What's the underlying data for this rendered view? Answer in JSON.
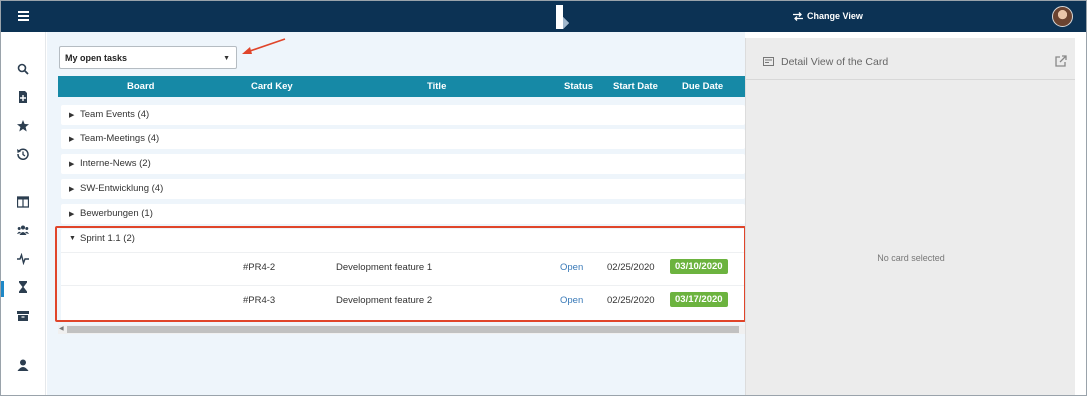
{
  "header": {
    "change_view_label": "Change View"
  },
  "filter": {
    "selected": "My open tasks"
  },
  "table": {
    "columns": {
      "board": "Board",
      "card_key": "Card Key",
      "title": "Title",
      "status": "Status",
      "start_date": "Start Date",
      "due_date": "Due Date"
    },
    "groups": [
      {
        "label": "Team Events (4)"
      },
      {
        "label": "Team-Meetings (4)"
      },
      {
        "label": "Interne-News (2)"
      },
      {
        "label": "SW-Entwicklung (4)"
      },
      {
        "label": "Bewerbungen (1)"
      },
      {
        "label": "Sprint 1.1 (2)"
      }
    ],
    "rows": [
      {
        "card_key": "#PR4-2",
        "title": "Development feature 1",
        "status": "Open",
        "start_date": "02/25/2020",
        "due_date": "03/10/2020"
      },
      {
        "card_key": "#PR4-3",
        "title": "Development feature 2",
        "status": "Open",
        "start_date": "02/25/2020",
        "due_date": "03/17/2020"
      }
    ]
  },
  "detail_panel": {
    "title": "Detail View of the Card",
    "empty_text": "No card selected"
  },
  "sidebar": {
    "icons": [
      "search-icon",
      "add-card-icon",
      "star-icon",
      "history-icon",
      "board-icon",
      "team-icon",
      "activity-icon",
      "hourglass-icon",
      "archive-icon",
      "user-icon"
    ]
  },
  "colors": {
    "topbar": "#0c3254",
    "table_header": "#1689a6",
    "due_badge": "#6cb33f",
    "highlight": "#e0452a",
    "status_link": "#3a7ab8"
  }
}
